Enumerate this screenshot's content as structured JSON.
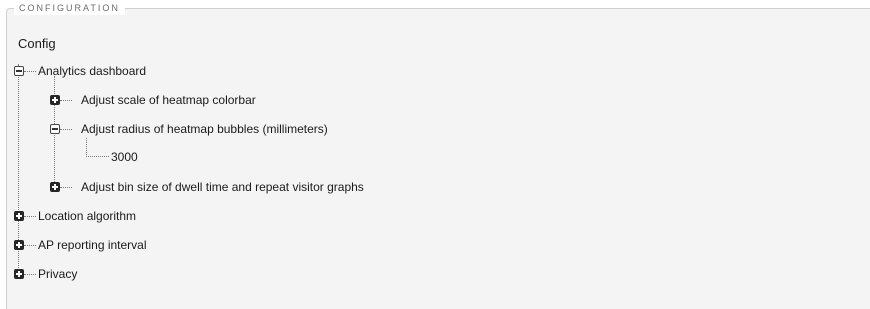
{
  "section": {
    "legend": "CONFIGURATION"
  },
  "tree": {
    "root_label": "Config",
    "analytics": {
      "label": "Analytics dashboard",
      "state": "expanded",
      "children": {
        "colorbar": {
          "label": "Adjust scale of heatmap colorbar",
          "state": "collapsed"
        },
        "radius": {
          "label": "Adjust radius of heatmap bubbles (millimeters)",
          "state": "expanded",
          "value": "3000"
        },
        "binsize": {
          "label": "Adjust bin size of dwell time and repeat visitor graphs",
          "state": "collapsed"
        }
      }
    },
    "location": {
      "label": "Location algorithm",
      "state": "collapsed"
    },
    "ap_interval": {
      "label": "AP reporting interval",
      "state": "collapsed"
    },
    "privacy": {
      "label": "Privacy",
      "state": "collapsed"
    }
  },
  "icons": {
    "expand": "plus-box-icon",
    "collapse": "minus-box-icon"
  }
}
